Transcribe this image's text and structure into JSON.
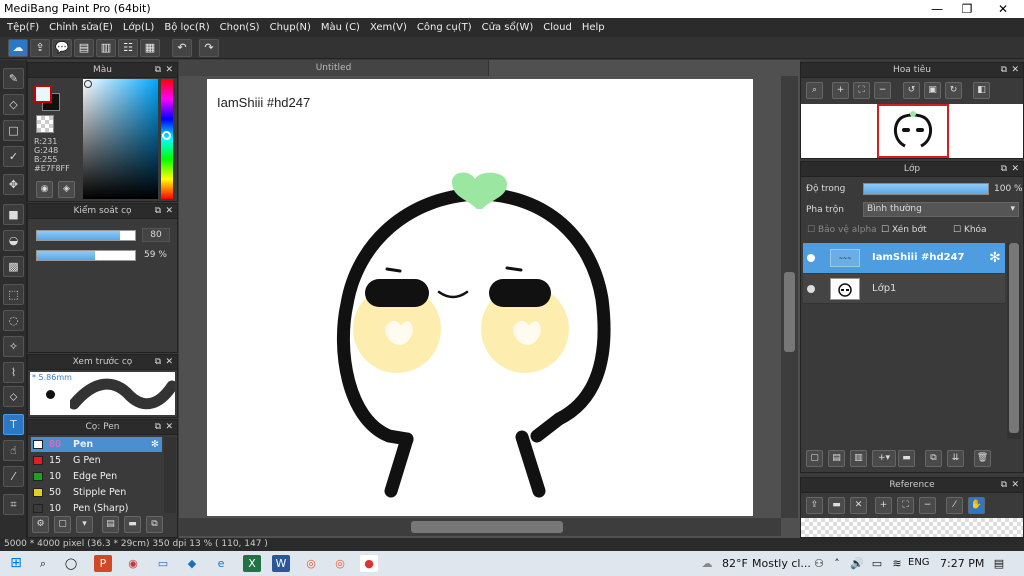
{
  "window": {
    "title": "MediBang Paint Pro (64bit)"
  },
  "menu": [
    "Tệp(F)",
    "Chỉnh sửa(E)",
    "Lớp(L)",
    "Bộ lọc(R)",
    "Chọn(S)",
    "Chụp(N)",
    "Màu (C)",
    "Xem(V)",
    "Công cụ(T)",
    "Cửa sổ(W)",
    "Cloud",
    "Help"
  ],
  "color_panel": {
    "title": "Màu",
    "r": "R:231",
    "g": "G:248",
    "b": "B:255",
    "hex": "#E7F8FF",
    "primary_color": "#e7f8ff",
    "secondary_color": "#cc0000"
  },
  "brush_control": {
    "title": "Kiểm soát cọ",
    "size_value": "80",
    "size_fraction": 0.85,
    "opacity_value": "59 %",
    "opacity_fraction": 0.59
  },
  "brush_preview": {
    "title": "Xem trước cọ",
    "size": "5.86mm"
  },
  "brush_list": {
    "title": "Cọ: Pen",
    "items": [
      {
        "size": "80",
        "name": "Pen",
        "color": "#ffffff",
        "selected": true
      },
      {
        "size": "15",
        "name": "G Pen",
        "color": "#e02020",
        "selected": false
      },
      {
        "size": "10",
        "name": "Edge Pen",
        "color": "#20a020",
        "selected": false
      },
      {
        "size": "50",
        "name": "Stipple Pen",
        "color": "#e0d020",
        "selected": false
      },
      {
        "size": "10",
        "name": "Pen (Sharp)",
        "color": "#3a3a3a",
        "selected": false
      }
    ]
  },
  "document": {
    "tab_title": "Untitled",
    "caption": "IamShiii #hd247"
  },
  "navigator": {
    "title": "Hoa tiêu"
  },
  "layers": {
    "title": "Lớp",
    "opacity_label": "Độ trong",
    "opacity_value": "100 %",
    "opacity_fraction": 1.0,
    "blend_label": "Pha trộn",
    "blend_value": "Bình thường",
    "protect_alpha": "Bảo vệ alpha",
    "clipping": "Xén bớt",
    "lock": "Khóa",
    "items": [
      {
        "name": "IamShiii #hd247",
        "selected": true
      },
      {
        "name": "Lớp1",
        "selected": false
      }
    ]
  },
  "reference": {
    "title": "Reference"
  },
  "status": {
    "size": "5000 * 4000 pixel",
    "dims": "(36.3 * 29cm)",
    "dpi": "350 dpi",
    "zoom": "13 %",
    "coords": "( 110, 147 )"
  },
  "taskbar": {
    "weather_temp": "82°F",
    "weather_text": "Mostly cl...",
    "lang": "ENG",
    "time": "7:27 PM"
  }
}
